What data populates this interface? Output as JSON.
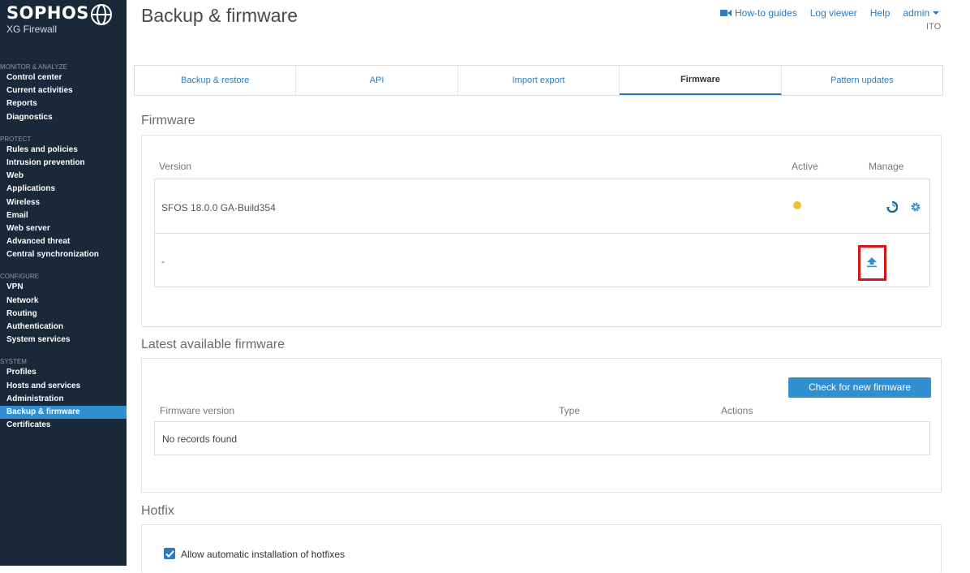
{
  "brand": {
    "name": "SOPHOS",
    "product": "XG Firewall"
  },
  "sidebar": {
    "sections": [
      {
        "label": "MONITOR & ANALYZE",
        "items": [
          "Control center",
          "Current activities",
          "Reports",
          "Diagnostics"
        ]
      },
      {
        "label": "PROTECT",
        "items": [
          "Rules and policies",
          "Intrusion prevention",
          "Web",
          "Applications",
          "Wireless",
          "Email",
          "Web server",
          "Advanced threat",
          "Central synchronization"
        ]
      },
      {
        "label": "CONFIGURE",
        "items": [
          "VPN",
          "Network",
          "Routing",
          "Authentication",
          "System services"
        ]
      },
      {
        "label": "SYSTEM",
        "items": [
          "Profiles",
          "Hosts and services",
          "Administration",
          "Backup & firmware",
          "Certificates"
        ]
      }
    ],
    "active_item": "Backup & firmware"
  },
  "header": {
    "title": "Backup & firmware",
    "links": {
      "howto": "How-to guides",
      "log": "Log viewer",
      "help": "Help",
      "user": "admin"
    },
    "user_sub": "ITO"
  },
  "tabs": [
    {
      "label": "Backup & restore",
      "active": false
    },
    {
      "label": "API",
      "active": false
    },
    {
      "label": "Import export",
      "active": false
    },
    {
      "label": "Firmware",
      "active": true
    },
    {
      "label": "Pattern updates",
      "active": false
    }
  ],
  "firmware": {
    "title": "Firmware",
    "columns": {
      "version": "Version",
      "active": "Active",
      "manage": "Manage"
    },
    "rows": [
      {
        "version": "SFOS 18.0.0 GA-Build354"
      },
      {
        "version": "-"
      }
    ]
  },
  "latest": {
    "title": "Latest available firmware",
    "check_button": "Check for new firmware",
    "columns": {
      "version": "Firmware version",
      "type": "Type",
      "actions": "Actions"
    },
    "empty": "No records found"
  },
  "hotfix": {
    "title": "Hotfix",
    "checkbox_label": "Allow automatic installation of hotfixes",
    "checked": true
  },
  "colors": {
    "sidebar": "#19293a",
    "accent": "#2f8fd1",
    "highlight": "#d01818",
    "active_dot": "#e8c23a"
  }
}
